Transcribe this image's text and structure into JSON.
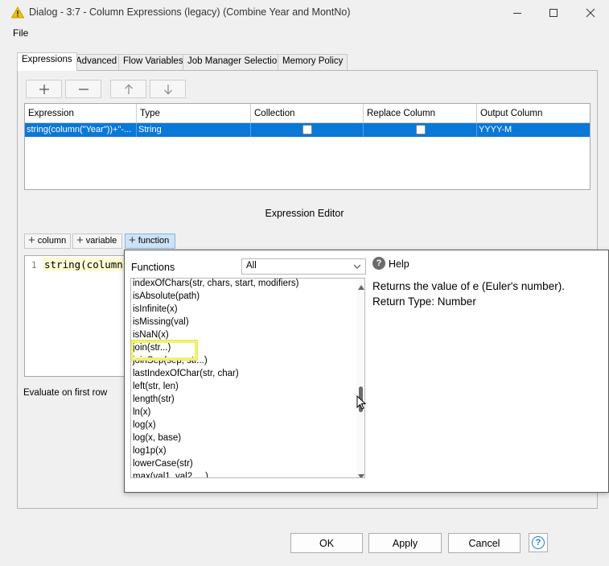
{
  "window": {
    "title": "Dialog - 3:7 - Column Expressions (legacy) (Combine Year and MontNo)",
    "controls": {
      "minimize": "minimize-icon",
      "maximize": "maximize-icon",
      "close": "close-icon"
    }
  },
  "menu": {
    "file": "File"
  },
  "tabs": [
    "Expressions",
    "Advanced",
    "Flow Variables",
    "Job Manager Selection",
    "Memory Policy"
  ],
  "table": {
    "headers": [
      "Expression",
      "Type",
      "Collection",
      "Replace Column",
      "Output Column"
    ],
    "row": {
      "expression": "string(column(\"Year\"))+\"-...",
      "type": "String",
      "collection": false,
      "replace_column": false,
      "output_column": "YYYY-M"
    }
  },
  "editor": {
    "title": "Expression Editor",
    "insert_buttons": [
      "column",
      "variable",
      "function"
    ],
    "line_number": "1",
    "code": "string(column(",
    "evaluate_label": "Evaluate on first row"
  },
  "functions_popup": {
    "label": "Functions",
    "category": "All",
    "items": [
      "indexOfChars(str, chars, start, modifiers)",
      "isAbsolute(path)",
      "isInfinite(x)",
      "isMissing(val)",
      "isNaN(x)",
      "join(str...)",
      "joinSep(sep, str...)",
      "lastIndexOfChar(str, char)",
      "left(str, len)",
      "length(str)",
      "ln(x)",
      "log(x)",
      "log(x, base)",
      "log1p(x)",
      "lowerCase(str)",
      "max(val1, val2, ...)"
    ],
    "highlighted": "isMissing(val)",
    "help_label": "Help",
    "help_text": "Returns the value of e (Euler's number).",
    "return_type": "Return Type: Number"
  },
  "buttons": {
    "ok": "OK",
    "apply": "Apply",
    "cancel": "Cancel",
    "help": "?"
  },
  "colors": {
    "selection": "#0a78d7",
    "highlight": "#f3f26a",
    "accent": "#1f7bd6"
  }
}
